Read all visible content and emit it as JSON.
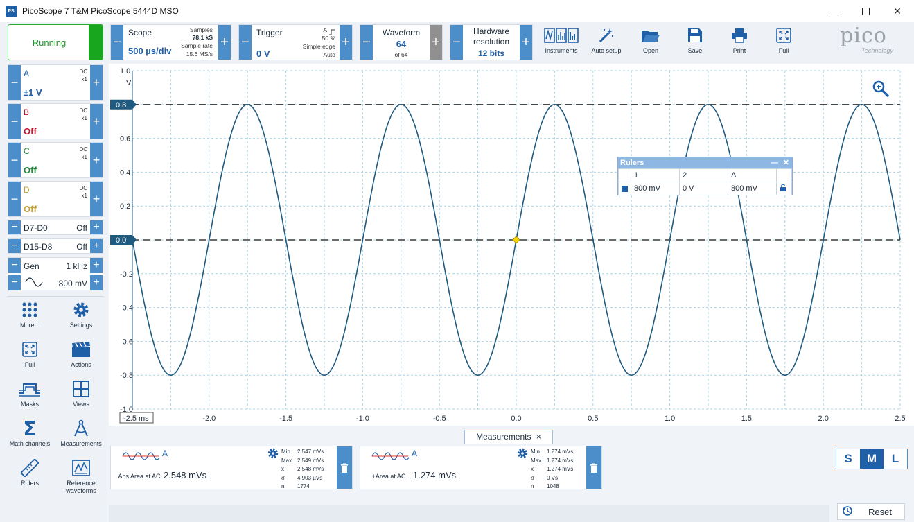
{
  "window": {
    "title": "PicoScope 7 T&M PicoScope 5444D MSO",
    "icon_text": "PS"
  },
  "status": {
    "run_label": "Running"
  },
  "scope": {
    "label": "Scope",
    "value": "500 µs/div",
    "samples_label": "Samples",
    "samples_value": "78.1 kS",
    "rate_label": "Sample rate",
    "rate_value": "15.6 MS/s"
  },
  "trigger": {
    "label": "Trigger",
    "value": "0 V",
    "channel": "A",
    "percent": "50 %",
    "type": "Simple edge",
    "mode": "Auto"
  },
  "waveform": {
    "label": "Waveform",
    "value": "64",
    "of": "of 64"
  },
  "hardware": {
    "label1": "Hardware",
    "label2": "resolution",
    "value": "12 bits"
  },
  "toolbar": {
    "instruments": "Instruments",
    "autosetup": "Auto setup",
    "open": "Open",
    "save": "Save",
    "print": "Print",
    "full": "Full"
  },
  "logo": {
    "text": "pico",
    "sub": "Technology"
  },
  "channels": [
    {
      "name": "A",
      "coupling": "DC",
      "probe": "x1",
      "value": "±1 V",
      "color": "#1f5fa8"
    },
    {
      "name": "B",
      "coupling": "DC",
      "probe": "x1",
      "value": "Off",
      "color": "#c8102e"
    },
    {
      "name": "C",
      "coupling": "DC",
      "probe": "x1",
      "value": "Off",
      "color": "#1e8a3a"
    },
    {
      "name": "D",
      "coupling": "DC",
      "probe": "x1",
      "value": "Off",
      "color": "#c9a227"
    }
  ],
  "digital": [
    {
      "name": "D7-D0",
      "value": "Off"
    },
    {
      "name": "D15-D8",
      "value": "Off"
    }
  ],
  "gen": {
    "label": "Gen",
    "freq": "1 kHz",
    "amp": "800 mV"
  },
  "left_tools": {
    "more": "More...",
    "settings": "Settings",
    "full": "Full",
    "actions": "Actions",
    "masks": "Masks",
    "views": "Views",
    "math": "Math channels",
    "measurements": "Measurements",
    "rulers": "Rulers",
    "reference": "Reference waveforms"
  },
  "chart_data": {
    "type": "line",
    "title": "",
    "ylabel": "V",
    "xlabel": "ms",
    "xlim": [
      -2.5,
      2.5
    ],
    "ylim": [
      -1.0,
      1.0
    ],
    "xticks": [
      "-2.5 ms",
      "-2.0",
      "-1.5",
      "-1.0",
      "-0.5",
      "0.0",
      "0.5",
      "1.0",
      "1.5",
      "2.0",
      "2.5"
    ],
    "yticks": [
      "1.0",
      "0.8",
      "0.6",
      "0.4",
      "0.2",
      "0.0",
      "-0.2",
      "-0.4",
      "-0.6",
      "-0.8",
      "-1.0"
    ],
    "grid": true,
    "series": [
      {
        "name": "A",
        "frequency_khz": 1,
        "amplitude_v": 0.8,
        "phase_note": "zero crossing rising at 0.0 ms",
        "color": "#1f5a80"
      }
    ],
    "rulers": [
      {
        "value": 0.8,
        "label": "0.8"
      },
      {
        "value": 0.0,
        "label": "0.0"
      }
    ]
  },
  "rulers_window": {
    "title": "Rulers",
    "h1": "1",
    "h2": "2",
    "h3": "Δ",
    "v1": "800 mV",
    "v2": "0 V",
    "v3": "800 mV"
  },
  "measurements_tab": {
    "label": "Measurements",
    "close": "×"
  },
  "measurements": [
    {
      "channel": "A",
      "name": "Abs Area at AC",
      "value": "2.548 mVs",
      "min": "2.547 mVs",
      "max": "2.549 mVs",
      "mean": "2.548 mVs",
      "sigma": "4.903 µVs",
      "n": "1774"
    },
    {
      "channel": "A",
      "name": "+Area at AC",
      "value": "1.274 mVs",
      "min": "1.274 mVs",
      "max": "1.274 mVs",
      "mean": "1.274 mVs",
      "sigma": "0 Vs",
      "n": "1048"
    }
  ],
  "stat_labels": {
    "min": "Min.",
    "max": "Max.",
    "mean": "x̄",
    "sigma": "σ",
    "n": "n"
  },
  "size_buttons": {
    "s": "S",
    "m": "M",
    "l": "L"
  },
  "reset_label": "Reset"
}
